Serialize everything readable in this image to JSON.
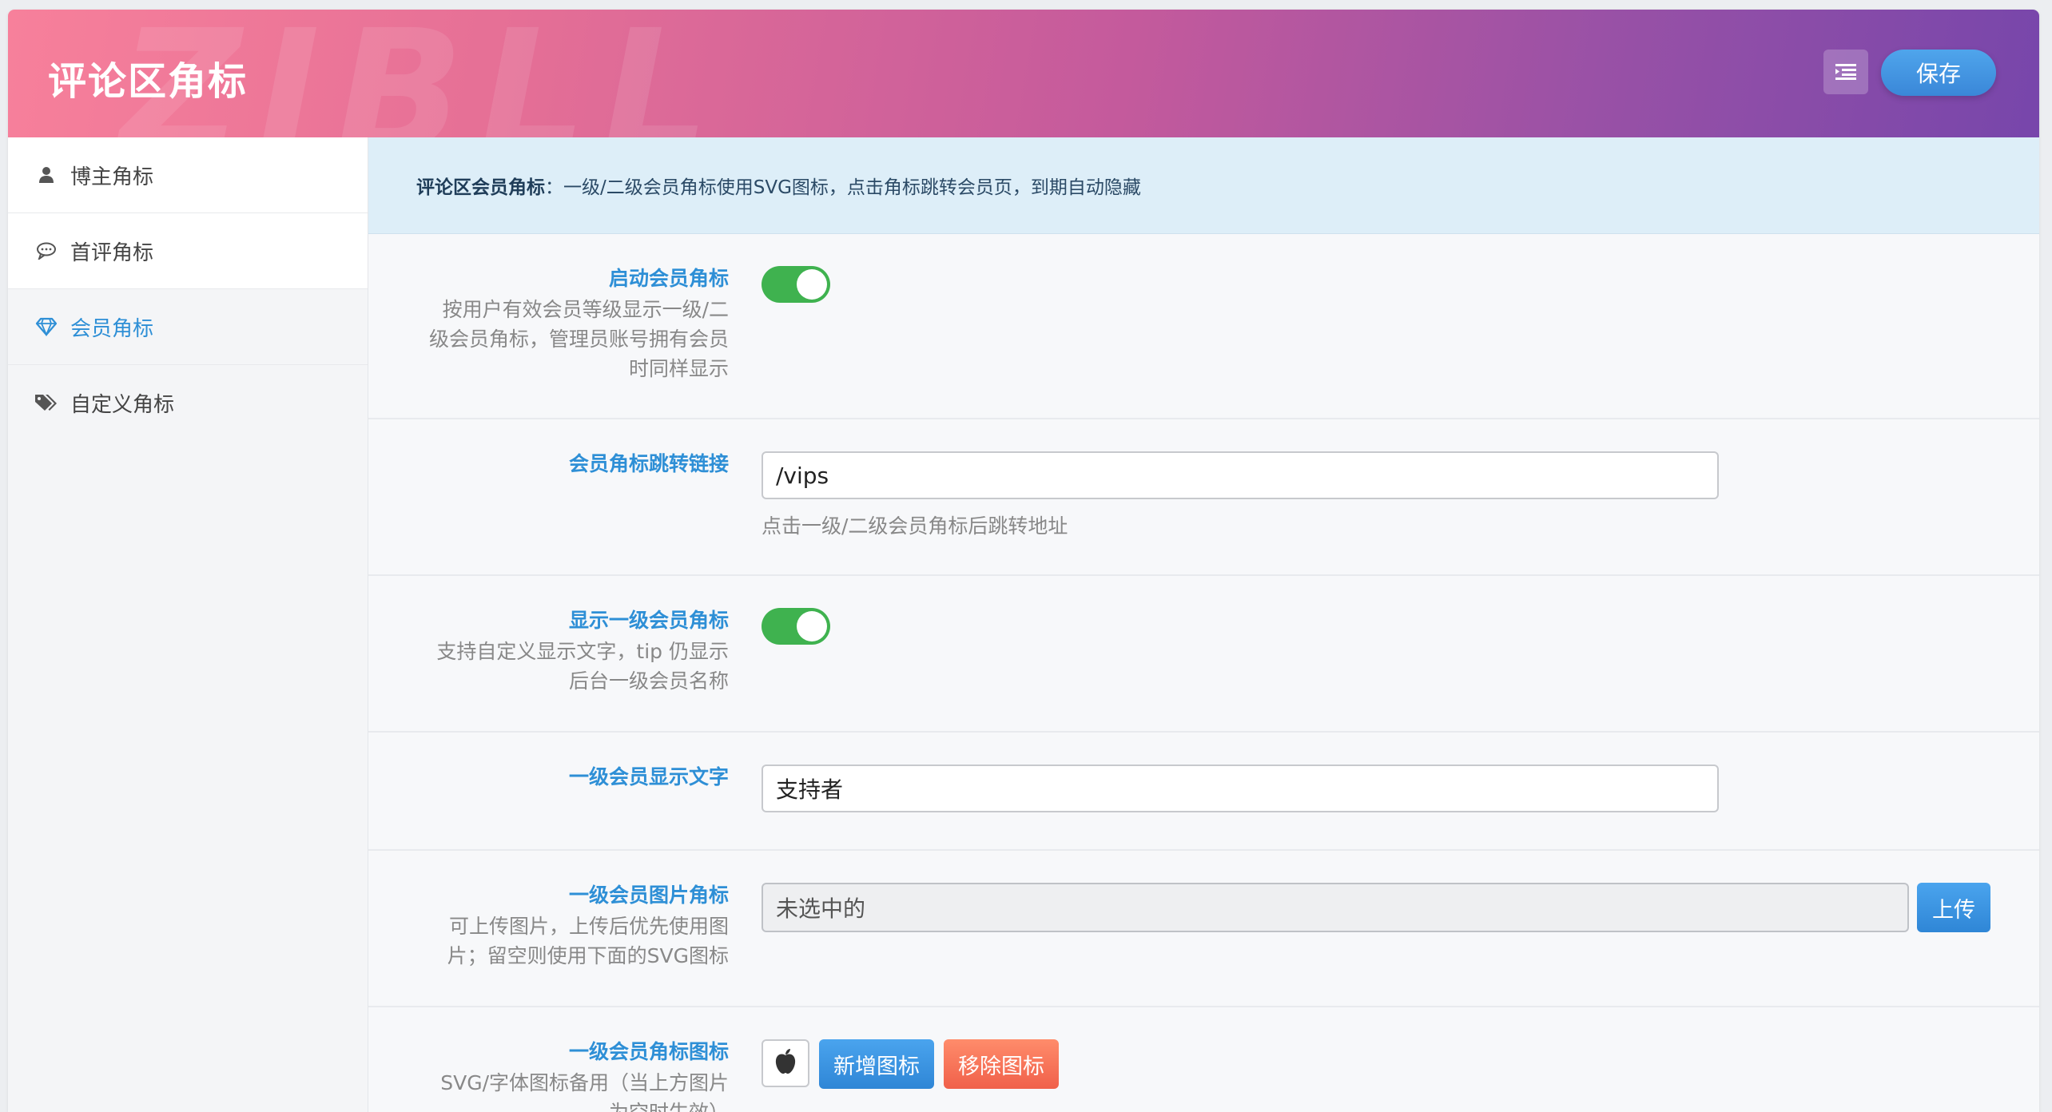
{
  "header": {
    "title": "评论区角标",
    "watermark": "ZIBLL",
    "save_label": "保存",
    "menu_icon": "list-menu-icon"
  },
  "sidebar": {
    "items": [
      {
        "label": "博主角标",
        "icon": "user-icon",
        "active": false
      },
      {
        "label": "首评角标",
        "icon": "comment-icon",
        "active": false
      },
      {
        "label": "会员角标",
        "icon": "diamond-icon",
        "active": true
      },
      {
        "label": "自定义角标",
        "icon": "tags-icon",
        "active": false
      }
    ]
  },
  "notice": {
    "bold": "评论区会员角标",
    "text": "：一级/二级会员角标使用SVG图标，点击角标跳转会员页，到期自动隐藏"
  },
  "fields": {
    "enable": {
      "title": "启动会员角标",
      "desc": [
        "按用户有效会员等级显示一级/二",
        "级会员角标，管理员账号拥有会员",
        "时同样显示"
      ],
      "value": true
    },
    "link": {
      "title": "会员角标跳转链接",
      "value": "/vips",
      "help": "点击一级/二级会员角标后跳转地址"
    },
    "show_level1": {
      "title": "显示一级会员角标",
      "desc": [
        "支持自定义显示文字，tip 仍显示",
        "后台一级会员名称"
      ],
      "value": true
    },
    "level1_text": {
      "title": "一级会员显示文字",
      "value": "支持者"
    },
    "level1_image": {
      "title": "一级会员图片角标",
      "desc": [
        "可上传图片，上传后优先使用图",
        "片；留空则使用下面的SVG图标"
      ],
      "value": "未选中的",
      "upload_label": "上传"
    },
    "level1_icon": {
      "title": "一级会员角标图标",
      "desc": [
        "SVG/字体图标备用（当上方图片",
        "为空时生效）"
      ],
      "icon": "apple-icon",
      "add_label": "新增图标",
      "remove_label": "移除图标"
    }
  },
  "colors": {
    "accent": "#2e8fd6",
    "toggle_on": "#3fb24f",
    "remove": "#f0604a"
  }
}
